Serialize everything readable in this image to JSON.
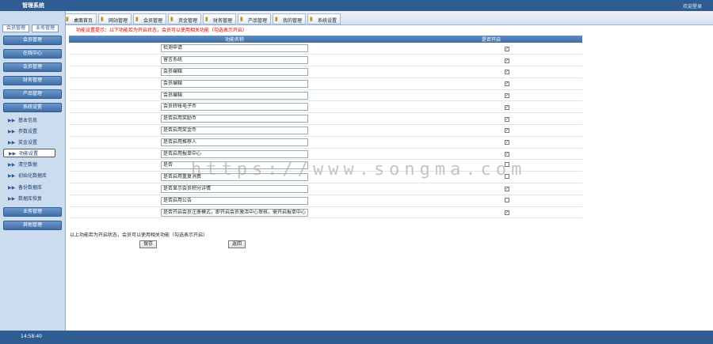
{
  "app": {
    "title": "管理系统",
    "top_right": "欢迎登录"
  },
  "tabs": [
    "桌面首页",
    "网站管理",
    "会员管理",
    "资金管理",
    "财务管理",
    "产品管理",
    "我的管理",
    "系统设置"
  ],
  "sidebar": {
    "top_buttons": [
      "会员管理",
      "业务管理"
    ],
    "sections_top": [
      "会员管理",
      "在线中心",
      "会员管理",
      "财务管理",
      "产品管理",
      "系统设置"
    ],
    "subitems": [
      "基本信息",
      "参数设置",
      "奖金设置",
      "功能设置",
      "清空数据",
      "初始化数据库",
      "备份数据库",
      "数据库恢复"
    ],
    "sections_bottom": [
      "业务管理",
      "其他管理"
    ]
  },
  "notice_red": "功能设置提示：以下功能若为开启状态，会员可以使用相关功能（勾选表示开启）",
  "table": {
    "headers": [
      "功能名称",
      "是否开启"
    ],
    "rows": [
      {
        "name": "检测申请",
        "checked": true
      },
      {
        "name": "留言系统",
        "checked": true
      },
      {
        "name": "会员编辑",
        "checked": true
      },
      {
        "name": "会员编辑",
        "checked": true
      },
      {
        "name": "会员编辑",
        "checked": true
      },
      {
        "name": "会员转帐电子币",
        "checked": true
      },
      {
        "name": "是否启用奖励币",
        "checked": true
      },
      {
        "name": "是否启用奖金币",
        "checked": true
      },
      {
        "name": "是否启用推荐人",
        "checked": true
      },
      {
        "name": "是否启用报单中心",
        "checked": true
      },
      {
        "name": "是否",
        "checked": false
      },
      {
        "name": "是否启用重复消费",
        "checked": false
      },
      {
        "name": "是否显示会员积分详情",
        "checked": true
      },
      {
        "name": "是否启用公告",
        "checked": false
      },
      {
        "name": "是否开启会员注册模式，即开启会员激活中心审核，需开启报单中心",
        "checked": true
      }
    ]
  },
  "notice_bottom": "以上功能若为开启状态，会员可以使用相关功能（勾选表示开启）",
  "buttons": {
    "save": "保存",
    "back": "返回"
  },
  "watermark": "https://www.songma.com",
  "status": {
    "time": "14:58:40"
  }
}
